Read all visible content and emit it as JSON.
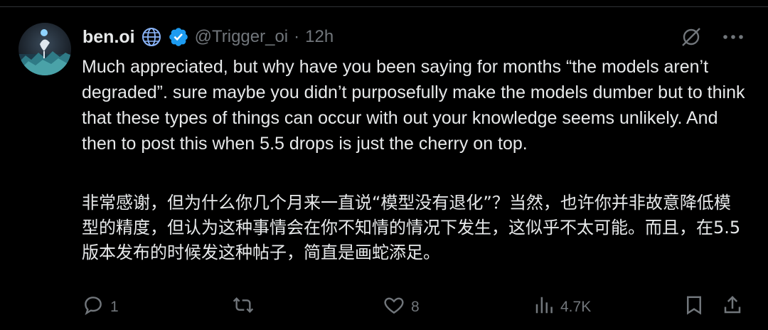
{
  "tweet": {
    "author": {
      "display_name": "ben.oi",
      "handle": "@Trigger_oi",
      "separator": "·",
      "time": "12h",
      "badges": [
        "globe-icon",
        "verified-badge-icon"
      ],
      "avatar": "avatar-image"
    },
    "text_en": "Much appreciated, but why have you been saying for months “the models aren’t degraded”. sure maybe you didn’t purposefully make the models dumber but to think that these types of things can occur with out your knowledge seems unlikely. And then to post this when 5.5 drops is just the cherry on top.",
    "text_cn": "非常感谢，但为什么你几个月来一直说“模型没有退化”？当然，也许你并非故意降低模型的精度，但认为这种事情会在你不知情的情况下发生，这似乎不太可能。而且，在5.5版本发布的时候发这种帖子，简直是画蛇添足。",
    "top_actions": [
      "grok-icon",
      "more-icon"
    ],
    "stats": {
      "replies": "1",
      "reposts": "",
      "likes": "8",
      "views": "4.7K"
    },
    "action_icons": [
      "reply-icon",
      "repost-icon",
      "like-icon",
      "views-icon",
      "bookmark-icon",
      "share-icon"
    ],
    "colors": {
      "background": "#000000",
      "text": "#e7e9ea",
      "muted": "#71767b",
      "verified": "#1d9bf0"
    }
  }
}
